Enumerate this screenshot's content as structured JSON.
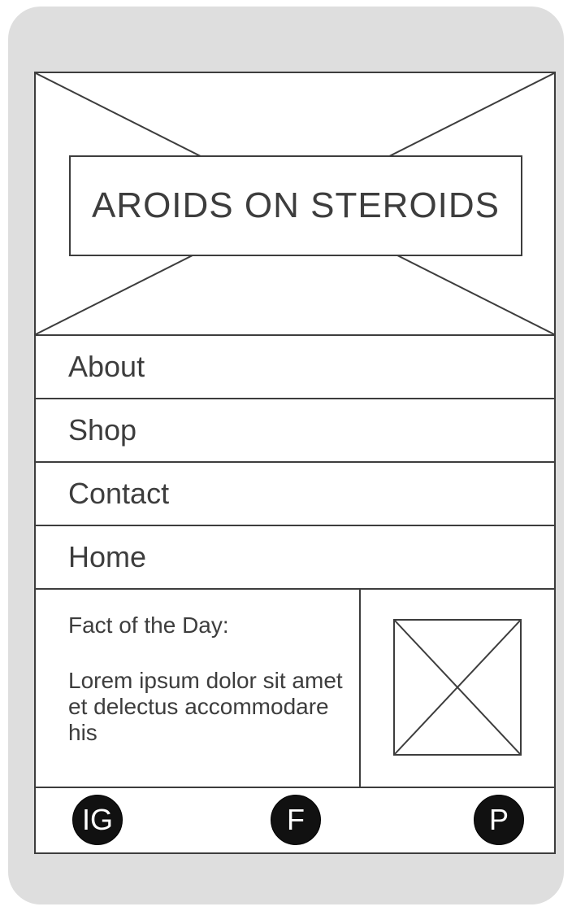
{
  "header": {
    "title": "AROIDS ON STEROIDS"
  },
  "nav": {
    "items": [
      {
        "label": "About"
      },
      {
        "label": "Shop"
      },
      {
        "label": "Contact"
      },
      {
        "label": "Home"
      }
    ]
  },
  "fact": {
    "title": "Fact of the Day:",
    "body": "Lorem ipsum dolor sit amet et delectus accommodare his"
  },
  "footer": {
    "social": [
      {
        "label": "IG",
        "icon": "instagram-icon"
      },
      {
        "label": "F",
        "icon": "facebook-icon"
      },
      {
        "label": "P",
        "icon": "pinterest-icon"
      }
    ]
  },
  "colors": {
    "device": "#dedede",
    "stroke": "#3d3d3d",
    "social": "#111111"
  }
}
